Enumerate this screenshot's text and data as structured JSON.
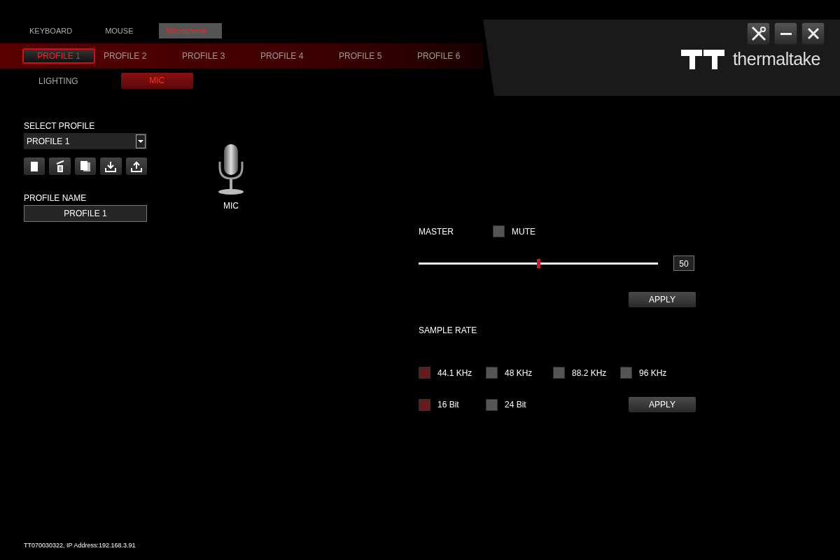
{
  "logo": {
    "text": "thermaltake"
  },
  "device_tabs": [
    {
      "label": "KEYBOARD",
      "selected": false
    },
    {
      "label": "MOUSE",
      "selected": false
    },
    {
      "label": "Microphone",
      "selected": true
    }
  ],
  "profile_tabs": [
    {
      "label": "PROFILE 1",
      "selected": true
    },
    {
      "label": "PROFILE 2",
      "selected": false
    },
    {
      "label": "PROFILE 3",
      "selected": false
    },
    {
      "label": "PROFILE 4",
      "selected": false
    },
    {
      "label": "PROFILE 5",
      "selected": false
    },
    {
      "label": "PROFILE 6",
      "selected": false
    }
  ],
  "sub_tabs": [
    {
      "label": "LIGHTING",
      "selected": false
    },
    {
      "label": "MIC",
      "selected": true
    }
  ],
  "select_profile": {
    "label": "SELECT PROFILE",
    "value": "PROFILE 1"
  },
  "profile_name": {
    "label": "PROFILE NAME",
    "value": "PROFILE 1"
  },
  "device": {
    "label": "MIC"
  },
  "master": {
    "label": "MASTER",
    "mute": {
      "label": "MUTE",
      "checked": false
    },
    "level": 0.5,
    "reading": "50",
    "apply": "APPLY"
  },
  "sample_rate": {
    "label": "SAMPLE RATE",
    "rates": [
      {
        "label": "44.1 KHz",
        "selected": true
      },
      {
        "label": "48 KHz",
        "selected": false
      },
      {
        "label": "88.2 KHz",
        "selected": false
      },
      {
        "label": "96 KHz",
        "selected": false
      }
    ],
    "bits": [
      {
        "label": "16 Bit",
        "selected": true
      },
      {
        "label": "24 Bit",
        "selected": false
      }
    ],
    "apply": "APPLY"
  },
  "status_bar": {
    "text": "TT070030322, IP Address:192.168.3.91"
  }
}
